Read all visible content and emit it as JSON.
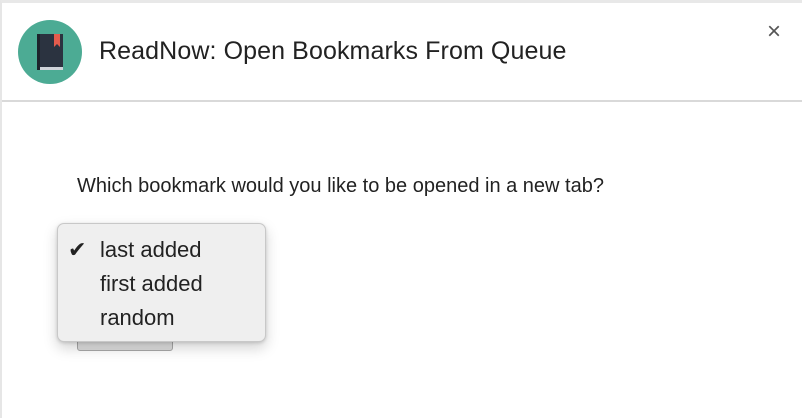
{
  "window": {
    "title": "ReadNow: Open Bookmarks From Queue",
    "close_label": "×",
    "app_icon": "book-icon",
    "accent_color": "#4cab94"
  },
  "main": {
    "question": "Which bookmark would you like to be opened in a new tab?"
  },
  "dropdown": {
    "selected": "last added",
    "check_mark": "✔",
    "options": [
      {
        "label": "last added"
      },
      {
        "label": "first added"
      },
      {
        "label": "random"
      }
    ]
  }
}
